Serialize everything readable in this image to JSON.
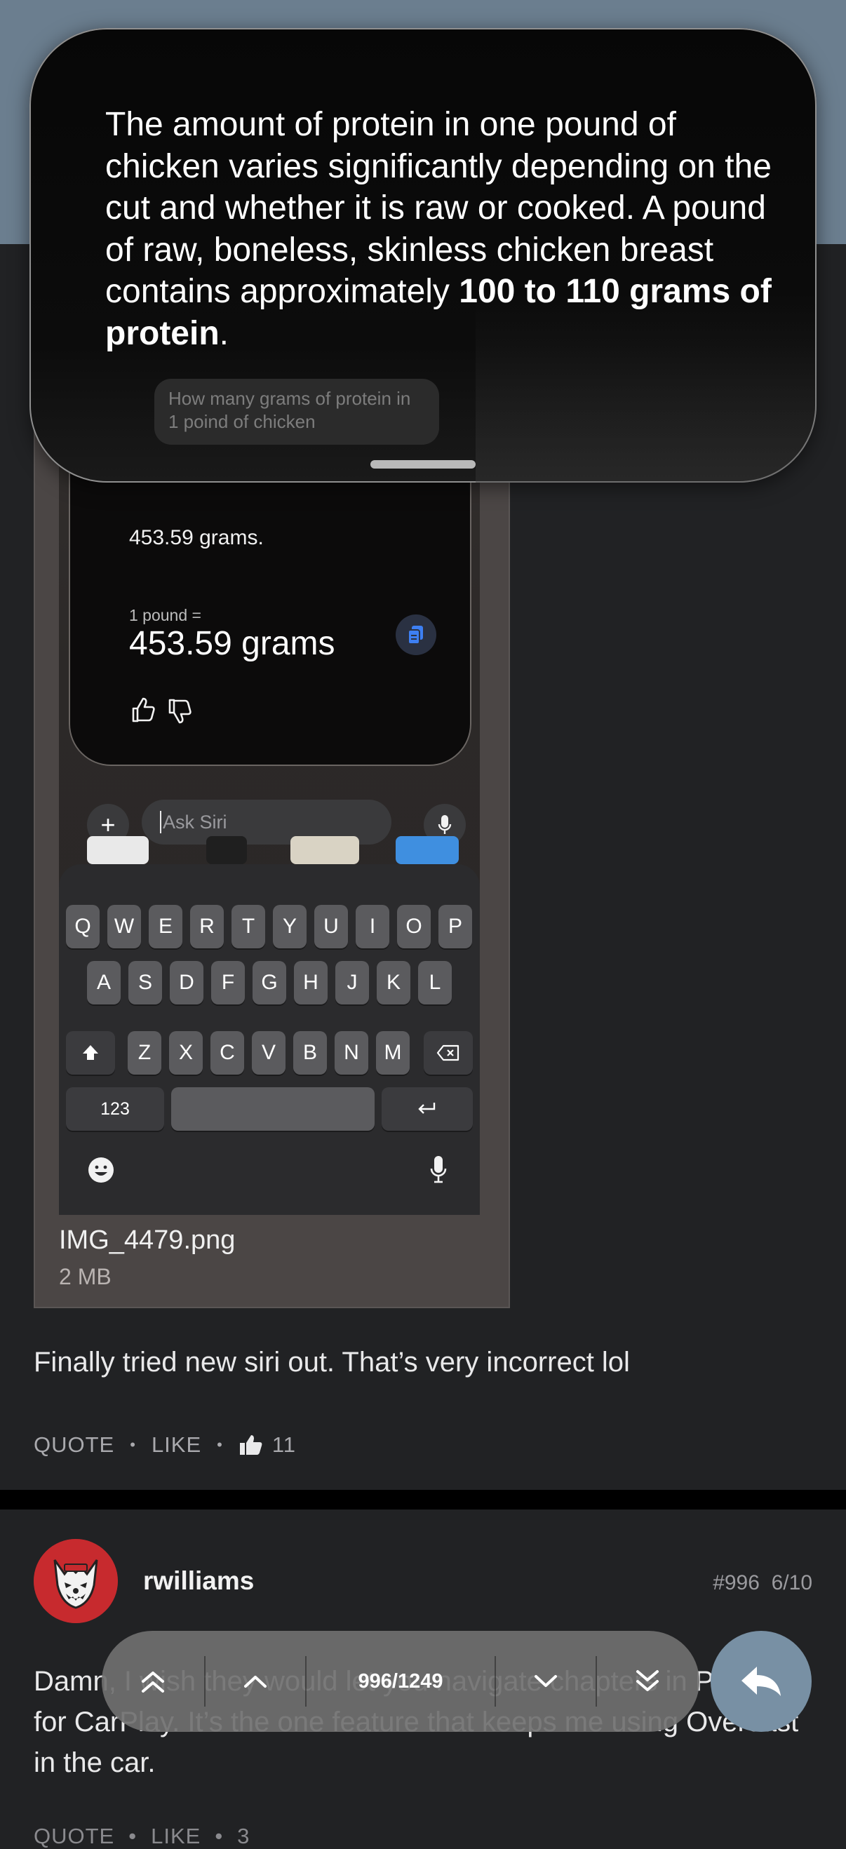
{
  "attachment": {
    "siri_answer_brief": "453.59 grams.",
    "conversion_label": "1 pound =",
    "conversion_value": "453.59 grams",
    "ask_placeholder": "Ask Siri",
    "keyboard": {
      "row1": [
        "Q",
        "W",
        "E",
        "R",
        "T",
        "Y",
        "U",
        "I",
        "O",
        "P"
      ],
      "row2": [
        "A",
        "S",
        "D",
        "F",
        "G",
        "H",
        "J",
        "K",
        "L"
      ],
      "row3": [
        "Z",
        "X",
        "C",
        "V",
        "B",
        "N",
        "M"
      ],
      "numbers_key": "123"
    },
    "file_name": "IMG_4479.png",
    "file_size": "2 MB"
  },
  "siri_bubble": {
    "answer_text": "The amount of protein in one pound of chicken varies significantly depending on the cut and whether it is raw or cooked. A pound of raw, boneless, skinless chicken breast contains approximately ",
    "answer_bold": "100 to 110 grams of protein",
    "answer_end": ".",
    "query_text": "How many grams of protein in 1 poind of chicken"
  },
  "post": {
    "text": "Finally tried new siri out. That’s very incorrect lol",
    "quote_label": "QUOTE",
    "like_label": "LIKE",
    "like_count": "11"
  },
  "next_post": {
    "username": "rwilliams",
    "post_number": "#996",
    "date": "6/10",
    "text": "Damn, I wish they would let you navigate chapters in Podcasts for CarPlay. It’s the one feature that keeps me using Overcast in the car.",
    "quote_label": "QUOTE",
    "like_label": "LIKE",
    "like_count": "3"
  },
  "nav": {
    "counter": "996/1249"
  },
  "colors": {
    "top_band": "#6b7e8f",
    "background": "#212224",
    "reply_fab": "#7890a4",
    "avatar": "#c72a2e"
  }
}
